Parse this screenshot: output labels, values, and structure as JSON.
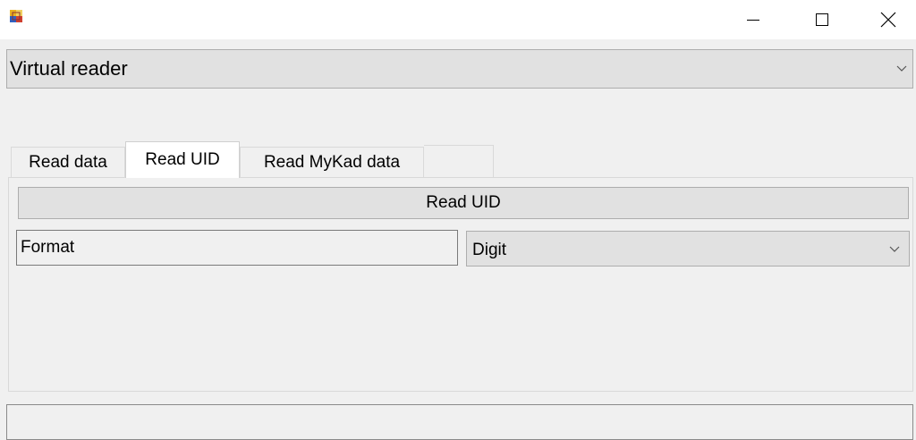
{
  "window": {
    "icon": "app-icon",
    "controls": {
      "minimize_icon": "minimize-icon",
      "maximize_icon": "maximize-icon",
      "close_icon": "close-icon"
    }
  },
  "reader": {
    "selected": "Virtual reader",
    "icon": "chevron-down-icon"
  },
  "tabs": [
    {
      "label": "Read data",
      "active": false
    },
    {
      "label": "Read UID",
      "active": true
    },
    {
      "label": "Read MyKad data",
      "active": false
    }
  ],
  "panel": {
    "action_button_label": "Read UID",
    "format_value": "Format",
    "format_select_value": "Digit"
  },
  "status_bar": {
    "text": ""
  }
}
